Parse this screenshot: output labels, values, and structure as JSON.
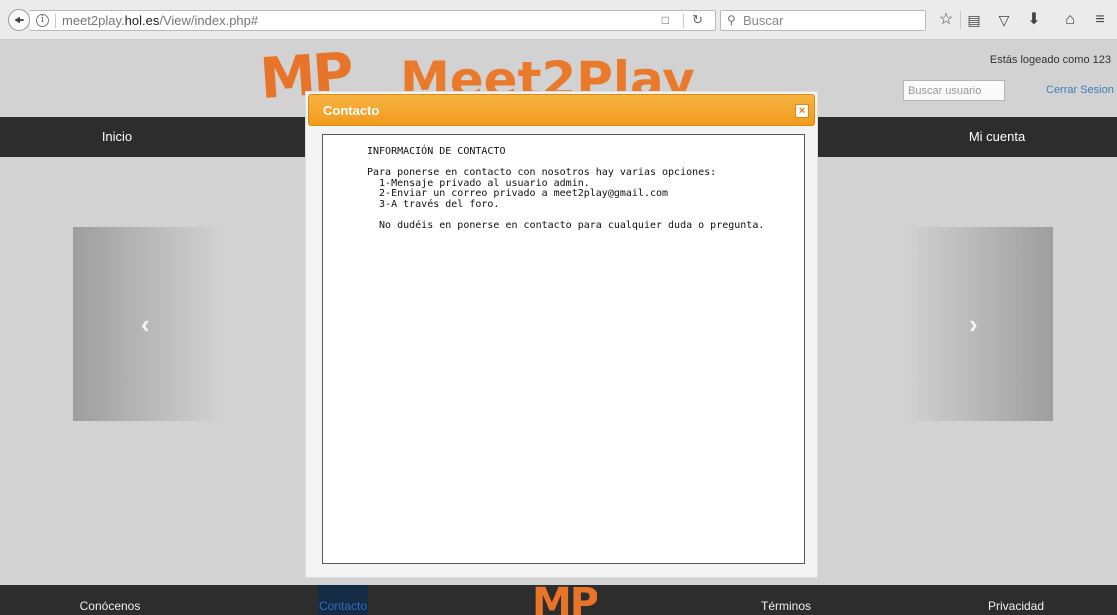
{
  "browser": {
    "url_prefix": "meet2play.",
    "url_domain": "hol.es",
    "url_path": "/View/index.php#",
    "search_placeholder": "Buscar",
    "toolbar_icons": [
      "bookmark-star-icon",
      "reading-list-icon",
      "pocket-icon",
      "download-icon",
      "home-icon",
      "menu-icon"
    ]
  },
  "header": {
    "logo_text": "MP",
    "brand_name": "Meet2Play",
    "logged_in_text": "Estás logeado como 123",
    "user_search_placeholder": "Buscar usuario",
    "logout_label": "Cerrar Sesion"
  },
  "nav": {
    "items": [
      {
        "label": "Inicio"
      },
      {
        "label": "Mi cuenta"
      }
    ]
  },
  "carousel": {
    "prev_glyph": "‹",
    "next_glyph": "›"
  },
  "dialog": {
    "title": "Contacto",
    "close_glyph": "×",
    "heading": "INFORMACIÓN DE CONTACTO",
    "intro": "Para ponerse en contacto con nosotros hay varias opciones:",
    "options": [
      "  1-Mensaje privado al usuario admin.",
      "  2-Enviar un correo privado a meet2play@gmail.com",
      "  3-A través del foro."
    ],
    "closing": "  No dudéis en ponerse en contacto para cualquier duda o pregunta."
  },
  "footer": {
    "items": [
      "Conócenos",
      "Contacto",
      "Términos",
      "Privacidad"
    ],
    "logo_text": "MP",
    "active_item": "Contacto"
  },
  "colors": {
    "brand_orange": "#e8742a",
    "nav_background": "#2d2d2d",
    "dialog_titlebar": "#f29b1d",
    "link_blue": "#3a7ec0"
  }
}
